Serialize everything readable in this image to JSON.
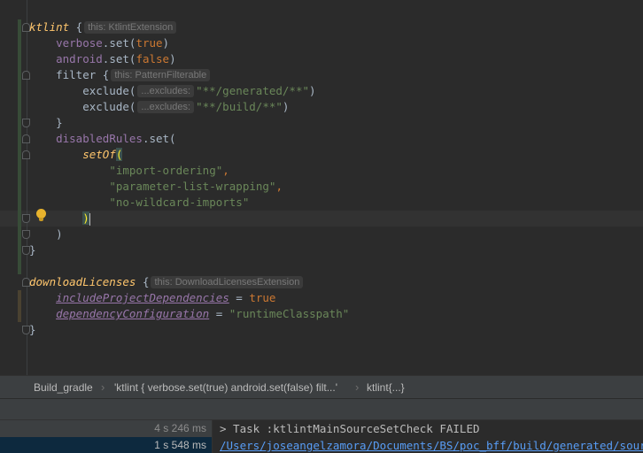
{
  "editor": {
    "lines": [
      {
        "id": "ktlint-open",
        "parts": [
          [
            "fn",
            "ktlint"
          ],
          [
            "plain",
            " {"
          ],
          [
            "hint",
            "this: KtlintExtension"
          ]
        ]
      },
      {
        "id": "verbose",
        "parts": [
          [
            "plain",
            "    "
          ],
          [
            "prop",
            "verbose"
          ],
          [
            "plain",
            ".set("
          ],
          [
            "kw",
            "true"
          ],
          [
            "plain",
            ")"
          ]
        ]
      },
      {
        "id": "android",
        "parts": [
          [
            "plain",
            "    "
          ],
          [
            "prop",
            "android"
          ],
          [
            "plain",
            ".set("
          ],
          [
            "kw",
            "false"
          ],
          [
            "plain",
            ")"
          ]
        ]
      },
      {
        "id": "filter-open",
        "parts": [
          [
            "plain",
            "    filter {"
          ],
          [
            "hint",
            "this: PatternFilterable"
          ]
        ]
      },
      {
        "id": "exclude-generated",
        "parts": [
          [
            "plain",
            "        exclude("
          ],
          [
            "hint",
            "...excludes:"
          ],
          [
            "str",
            "\"**/generated/**\""
          ],
          [
            "plain",
            ")"
          ]
        ]
      },
      {
        "id": "exclude-build",
        "parts": [
          [
            "plain",
            "        exclude("
          ],
          [
            "hint",
            "...excludes:"
          ],
          [
            "str",
            "\"**/build/**\""
          ],
          [
            "plain",
            ")"
          ]
        ]
      },
      {
        "id": "filter-close",
        "parts": [
          [
            "plain",
            "    }"
          ]
        ]
      },
      {
        "id": "disabled-rules",
        "parts": [
          [
            "plain",
            "    "
          ],
          [
            "prop",
            "disabledRules"
          ],
          [
            "plain",
            ".set("
          ]
        ]
      },
      {
        "id": "setof-open",
        "parts": [
          [
            "plain",
            "        "
          ],
          [
            "fn",
            "setOf"
          ],
          [
            "paren",
            "("
          ]
        ]
      },
      {
        "id": "rule-import-ordering",
        "parts": [
          [
            "plain",
            "            "
          ],
          [
            "str",
            "\"import-ordering\""
          ],
          [
            "kw",
            ","
          ]
        ]
      },
      {
        "id": "rule-parameter-list",
        "parts": [
          [
            "plain",
            "            "
          ],
          [
            "str",
            "\"parameter-list-wrapping\""
          ],
          [
            "kw",
            ","
          ]
        ]
      },
      {
        "id": "rule-no-wildcard",
        "parts": [
          [
            "plain",
            "            "
          ],
          [
            "str",
            "\"no-wildcard-imports\""
          ]
        ]
      },
      {
        "id": "setof-close",
        "parts": [
          [
            "plain",
            "        "
          ],
          [
            "paren",
            ")"
          ],
          [
            "caret",
            ""
          ]
        ]
      },
      {
        "id": "set-close",
        "parts": [
          [
            "plain",
            "    )"
          ]
        ]
      },
      {
        "id": "ktlint-close",
        "parts": [
          [
            "plain",
            "}"
          ]
        ]
      },
      {
        "id": "blank",
        "parts": []
      },
      {
        "id": "download-open",
        "parts": [
          [
            "fn",
            "downloadLicenses"
          ],
          [
            "plain",
            " {"
          ],
          [
            "hint",
            "this: DownloadLicensesExtension"
          ]
        ]
      },
      {
        "id": "include-project-deps",
        "parts": [
          [
            "plain",
            "    "
          ],
          [
            "ext",
            "includeProjectDependencies"
          ],
          [
            "plain",
            " = "
          ],
          [
            "kw",
            "true"
          ]
        ]
      },
      {
        "id": "dependency-config",
        "parts": [
          [
            "plain",
            "    "
          ],
          [
            "ext",
            "dependencyConfiguration"
          ],
          [
            "plain",
            " = "
          ],
          [
            "str",
            "\"runtimeClasspath\""
          ]
        ]
      },
      {
        "id": "download-close",
        "parts": [
          [
            "plain",
            "}"
          ]
        ]
      }
    ]
  },
  "breadcrumb": {
    "items": [
      "Build_gradle",
      "'ktlint { verbose.set(true) android.set(false) filt...'",
      "ktlint{...}"
    ]
  },
  "run_tree": {
    "rows": [
      {
        "time": "4 s 246 ms",
        "selected": false
      },
      {
        "time": "1 s 548 ms",
        "selected": true
      }
    ]
  },
  "console": {
    "task_line": "> Task :ktlintMainSourceSetCheck FAILED",
    "path_line": "/Users/joseangelzamora/Documents/BS/poc_bff/build/generated/source/g"
  },
  "colors": {
    "keyword": "#cc7832",
    "property": "#9876aa",
    "function": "#ffc66d",
    "string": "#6a8759",
    "default_text": "#a9b7c6",
    "link": "#589df6"
  }
}
